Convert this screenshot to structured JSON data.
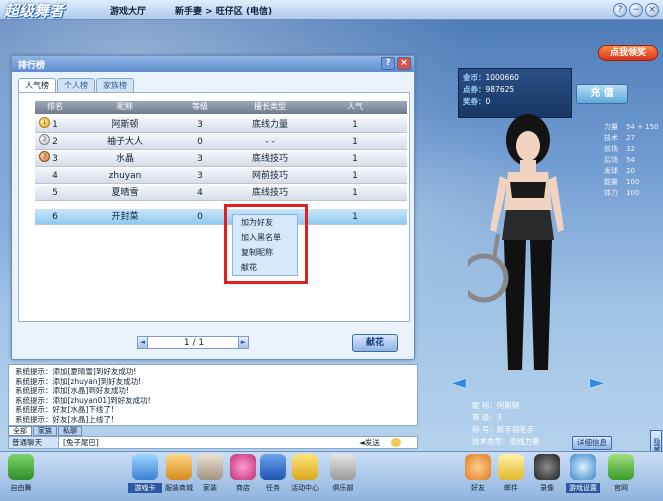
{
  "app": {
    "logo": "超级舞者",
    "breadcrumb": {
      "section": "游戏大厅",
      "path": "新手妻 > 旺仔区 (电信)"
    }
  },
  "window_controls": [
    "?",
    "−",
    "×"
  ],
  "dialog": {
    "title": "排行榜",
    "tabs": [
      "人气榜",
      "个人榜",
      "家族榜"
    ],
    "columns": [
      "排名",
      "昵称",
      "等级",
      "擅长类型",
      "人气"
    ],
    "rows": [
      {
        "rank": "1",
        "name": "阿斯顿",
        "level": "3",
        "type": "底线力量",
        "pop": "1"
      },
      {
        "rank": "2",
        "name": "袖子大人",
        "level": "0",
        "type": "- -",
        "pop": "1"
      },
      {
        "rank": "3",
        "name": "水晶",
        "level": "3",
        "type": "底线技巧",
        "pop": "1"
      },
      {
        "rank": "4",
        "name": "zhuyan",
        "level": "3",
        "type": "网前技巧",
        "pop": "1"
      },
      {
        "rank": "5",
        "name": "夏晴雪",
        "level": "4",
        "type": "底线技巧",
        "pop": "1"
      },
      {
        "rank": "6",
        "name": "开封菜",
        "level": "0",
        "type": "",
        "pop": "1"
      }
    ],
    "pager": {
      "text": "1 / 1"
    },
    "flower_button": "献花",
    "context_menu": [
      "加为好友",
      "加入黑名单",
      "复制昵称",
      "献花"
    ]
  },
  "chat": {
    "lines": [
      "系统提示：添加[夏晴雪]到好友成功!",
      "系统提示：添加[zhuyan]到好友成功!",
      "系统提示：添加[水晶]到好友成功!",
      "系统提示：添加[zhuyan01]到好友成功!",
      "系统提示：好友[水晶]下线了!",
      "系统提示：好友[水晶]上线了!"
    ],
    "tabs": [
      "全部",
      "家族",
      "私聊"
    ],
    "channel": "普通聊天",
    "emote": "[兔子尾巴]",
    "send_label": "◄发送"
  },
  "account": {
    "gold_label": "金币：",
    "gold": "1000660",
    "points_label": "点券：",
    "points": "987625",
    "honor_label": "奖券：",
    "honor": "0",
    "charge_button": "充  值"
  },
  "gift_button": "点我领奖",
  "attributes": [
    {
      "label": "力量",
      "value": "54 + 150"
    },
    {
      "label": "技术",
      "value": "27"
    },
    {
      "label": "前场",
      "value": "32"
    },
    {
      "label": "后场",
      "value": "54"
    },
    {
      "label": "发球",
      "value": "20"
    },
    {
      "label": "能量",
      "value": "100"
    },
    {
      "label": "体力",
      "value": "100"
    }
  ],
  "profile": {
    "rows": [
      {
        "label": "昵  称：",
        "value": "阿斯顿"
      },
      {
        "label": "等  级：",
        "value": "3"
      },
      {
        "label": "称  号：",
        "value": "新手羽毛手"
      },
      {
        "label": "技术类型：",
        "value": "底线力量"
      }
    ],
    "detail_button": "详细信息",
    "hide_button": "隐藏界面"
  },
  "toolbar": {
    "items": [
      "自由舞",
      "游戏卡",
      "服装商城",
      "家装",
      "商店",
      "任务",
      "活动中心",
      "俱乐部",
      "好友",
      "邮件",
      "录像",
      "游戏设置",
      "官网"
    ]
  }
}
